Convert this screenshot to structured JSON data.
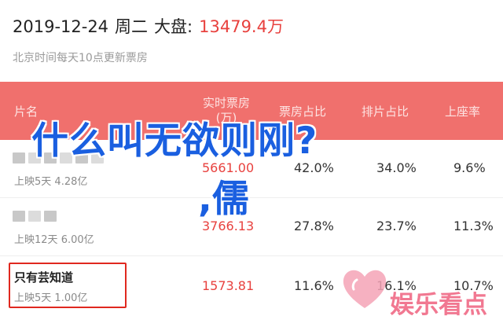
{
  "header": {
    "date": "2019-12-24",
    "weekday": "周二",
    "total_label": "大盘:",
    "total_value": "13479.4万",
    "update_note": "北京时间每天10点更新票房"
  },
  "table": {
    "columns": {
      "film": "片名",
      "box_office_line1": "实时票房",
      "box_office_line2": "(万)",
      "box_share": "票房占比",
      "show_share": "排片占比",
      "occupancy": "上座率"
    },
    "rows": [
      {
        "sub_label": "上映5天",
        "sub_value": "4.28亿",
        "box_office": "5661.00",
        "box_share": "42.0%",
        "show_share": "34.0%",
        "occupancy": "9.6%"
      },
      {
        "sub_label": "上映12天",
        "sub_value": "6.00亿",
        "box_office": "3766.13",
        "box_share": "27.8%",
        "show_share": "23.7%",
        "occupancy": "11.3%"
      },
      {
        "name": "只有芸知道",
        "sub_label": "上映5天",
        "sub_value": "1.00亿",
        "box_office": "1573.81",
        "box_share": "11.6%",
        "show_share": "16.1%",
        "occupancy": "10.7%"
      }
    ]
  },
  "overlay": {
    "title": "什么叫无欲则刚?",
    "subtitle": ",儒"
  },
  "watermark": {
    "text": "娱乐看点",
    "icon": "heart-icon"
  },
  "colors": {
    "header_bg": "#f0706d",
    "accent_red": "#e8413e",
    "overlay_blue": "#1a5fe0",
    "watermark_pink": "#f06a86"
  }
}
